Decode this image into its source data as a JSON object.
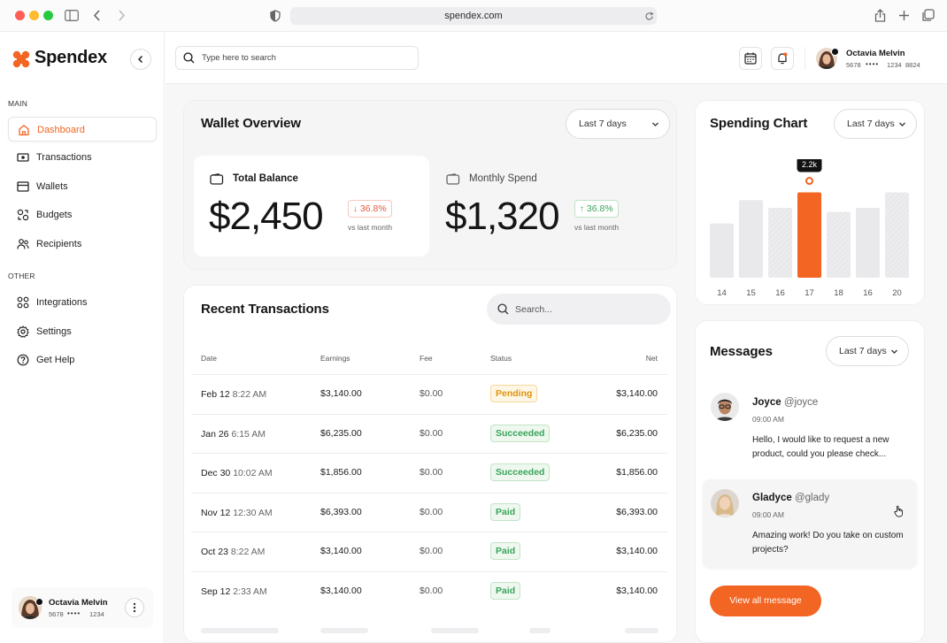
{
  "browser": {
    "url": "spendex.com"
  },
  "app": {
    "name": "Spendex",
    "accent": "#F26522"
  },
  "sidebar": {
    "main_label": "MAIN",
    "other_label": "OTHER",
    "main_items": [
      {
        "label": "Dashboard",
        "icon": "home-icon"
      },
      {
        "label": "Transactions",
        "icon": "cash-icon"
      },
      {
        "label": "Wallets",
        "icon": "wallet-icon"
      },
      {
        "label": "Budgets",
        "icon": "budget-icon"
      },
      {
        "label": "Recipients",
        "icon": "users-icon"
      }
    ],
    "other_items": [
      {
        "label": "Integrations",
        "icon": "grid-icon"
      },
      {
        "label": "Settings",
        "icon": "gear-icon"
      },
      {
        "label": "Get Help",
        "icon": "help-icon"
      }
    ],
    "user": {
      "name": "Octavia Melvin",
      "card_first": "5678",
      "card_mask": "••••",
      "card_last": "1234"
    }
  },
  "header": {
    "search_placeholder": "Type here to search",
    "user": {
      "name": "Octavia Melvin",
      "card_first": "5678",
      "card_mask": "••••",
      "card_mid": "1234",
      "card_last": "8824"
    }
  },
  "wallet": {
    "title": "Wallet Overview",
    "range": "Last 7 days",
    "total": {
      "label": "Total Balance",
      "value": "$2,450",
      "change": "36.8%",
      "direction": "down",
      "note": "vs last month"
    },
    "monthly": {
      "label": "Monthly Spend",
      "value": "$1,320",
      "change": "36.8%",
      "direction": "up",
      "note": "vs last month"
    }
  },
  "transactions": {
    "title": "Recent Transactions",
    "search_placeholder": "Search...",
    "columns": [
      "Date",
      "Earnings",
      "Fee",
      "Status",
      "Net"
    ],
    "rows": [
      {
        "date": "Feb 12",
        "time": "8:22 AM",
        "earnings": "$3,140.00",
        "fee": "$0.00",
        "status": "Pending",
        "net": "$3,140.00"
      },
      {
        "date": "Jan 26",
        "time": "6:15 AM",
        "earnings": "$6,235.00",
        "fee": "$0.00",
        "status": "Succeeded",
        "net": "$6,235.00"
      },
      {
        "date": "Dec 30",
        "time": "10:02 AM",
        "earnings": "$1,856.00",
        "fee": "$0.00",
        "status": "Succeeded",
        "net": "$1,856.00"
      },
      {
        "date": "Nov 12",
        "time": "12:30 AM",
        "earnings": "$6,393.00",
        "fee": "$0.00",
        "status": "Paid",
        "net": "$6,393.00"
      },
      {
        "date": "Oct 23",
        "time": "8:22 AM",
        "earnings": "$3,140.00",
        "fee": "$0.00",
        "status": "Paid",
        "net": "$3,140.00"
      },
      {
        "date": "Sep 12",
        "time": "2:33 AM",
        "earnings": "$3,140.00",
        "fee": "$0.00",
        "status": "Paid",
        "net": "$3,140.00"
      }
    ]
  },
  "spending": {
    "title": "Spending Chart",
    "range": "Last 7 days",
    "tooltip": "2.2k",
    "highlight_color": "#F26522",
    "chart_data": {
      "type": "bar",
      "categories": [
        "14",
        "15",
        "16",
        "17",
        "18",
        "16",
        "20"
      ],
      "values": [
        1.4,
        2.0,
        1.8,
        2.2,
        1.7,
        1.8,
        2.2
      ],
      "highlight_index": 3
    }
  },
  "messages": {
    "title": "Messages",
    "range": "Last 7 days",
    "items": [
      {
        "name": "Joyce",
        "handle": "@joyce",
        "time": "09:00 AM",
        "text": "Hello, I would like to request a new product, could you please check..."
      },
      {
        "name": "Gladyce",
        "handle": "@glady",
        "time": "09:00 AM",
        "text": "Amazing work! Do you take on custom projects?"
      }
    ],
    "view_all": "View all message"
  }
}
